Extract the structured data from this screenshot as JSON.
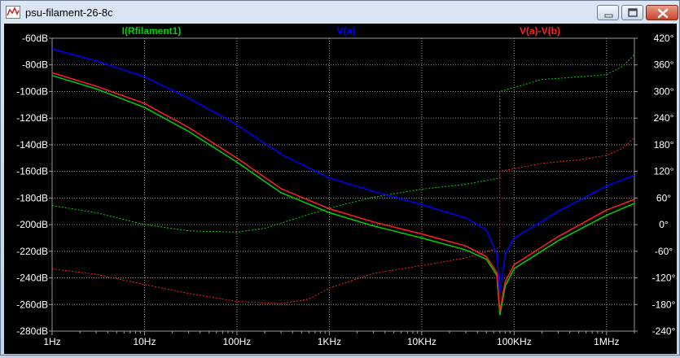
{
  "window": {
    "title": "psu-filament-26-8c",
    "minimize_label": "",
    "maximize_label": "",
    "close_label": ""
  },
  "colors": {
    "background": "#000000",
    "grid": "#999999",
    "trace_rfilament": "#00d000",
    "trace_va": "#0000ff",
    "trace_vavb": "#ff2020",
    "axis_text": "#ffffff"
  },
  "chart_data": {
    "type": "line",
    "x_scale": "log",
    "xlim": [
      1,
      2000000
    ],
    "ylim_left": [
      -280,
      -60
    ],
    "ylim_right": [
      -240,
      420
    ],
    "x_ticks": [
      {
        "value": 1,
        "label": "1Hz"
      },
      {
        "value": 10,
        "label": "10Hz"
      },
      {
        "value": 100,
        "label": "100Hz"
      },
      {
        "value": 1000,
        "label": "1KHz"
      },
      {
        "value": 10000,
        "label": "10KHz"
      },
      {
        "value": 100000,
        "label": "100KHz"
      },
      {
        "value": 1000000,
        "label": "1MHz"
      }
    ],
    "y_ticks_left": [
      {
        "value": -60,
        "label": "-60dB"
      },
      {
        "value": -80,
        "label": "-80dB"
      },
      {
        "value": -100,
        "label": "-100dB"
      },
      {
        "value": -120,
        "label": "-120dB"
      },
      {
        "value": -140,
        "label": "-140dB"
      },
      {
        "value": -160,
        "label": "-160dB"
      },
      {
        "value": -180,
        "label": "-180dB"
      },
      {
        "value": -200,
        "label": "-200dB"
      },
      {
        "value": -220,
        "label": "-220dB"
      },
      {
        "value": -240,
        "label": "-240dB"
      },
      {
        "value": -260,
        "label": "-260dB"
      },
      {
        "value": -280,
        "label": "-280dB"
      }
    ],
    "y_ticks_right": [
      {
        "value": 420,
        "label": "420°"
      },
      {
        "value": 360,
        "label": "360°"
      },
      {
        "value": 300,
        "label": "300°"
      },
      {
        "value": 240,
        "label": "240°"
      },
      {
        "value": 180,
        "label": "180°"
      },
      {
        "value": 120,
        "label": "120°"
      },
      {
        "value": 60,
        "label": "60°"
      },
      {
        "value": 0,
        "label": "0°"
      },
      {
        "value": -60,
        "label": "-60°"
      },
      {
        "value": -120,
        "label": "-120°"
      },
      {
        "value": -180,
        "label": "-180°"
      },
      {
        "value": -240,
        "label": "-240°"
      }
    ],
    "grid": true,
    "series": [
      {
        "name": "I(Rfilament1)",
        "color": "#00d000",
        "magnitude": [
          [
            1,
            -88
          ],
          [
            3,
            -98
          ],
          [
            10,
            -112
          ],
          [
            30,
            -130
          ],
          [
            100,
            -153
          ],
          [
            300,
            -176
          ],
          [
            1000,
            -191
          ],
          [
            3000,
            -201
          ],
          [
            10000,
            -210
          ],
          [
            30000,
            -219
          ],
          [
            50000,
            -226
          ],
          [
            65000,
            -238
          ],
          [
            70000,
            -268
          ],
          [
            80000,
            -246
          ],
          [
            100000,
            -233
          ],
          [
            300000,
            -212
          ],
          [
            1000000,
            -193
          ],
          [
            2000000,
            -184
          ]
        ],
        "phase": [
          [
            1,
            43
          ],
          [
            3,
            27
          ],
          [
            10,
            0
          ],
          [
            30,
            -14
          ],
          [
            100,
            -17
          ],
          [
            200,
            -8
          ],
          [
            500,
            18
          ],
          [
            1000,
            37
          ],
          [
            3000,
            62
          ],
          [
            10000,
            80
          ],
          [
            30000,
            91
          ],
          [
            70000,
            105
          ],
          [
            70001,
            300
          ],
          [
            200000,
            327
          ],
          [
            500000,
            333
          ],
          [
            1000000,
            338
          ],
          [
            1500000,
            357
          ],
          [
            2000000,
            383
          ]
        ]
      },
      {
        "name": "V(a)",
        "color": "#0000ff",
        "magnitude": [
          [
            1,
            -68
          ],
          [
            3,
            -77
          ],
          [
            10,
            -89
          ],
          [
            30,
            -105
          ],
          [
            100,
            -125
          ],
          [
            300,
            -147
          ],
          [
            1000,
            -165
          ],
          [
            3000,
            -175
          ],
          [
            10000,
            -185
          ],
          [
            30000,
            -195
          ],
          [
            50000,
            -204
          ],
          [
            65000,
            -222
          ],
          [
            70000,
            -251
          ],
          [
            80000,
            -222
          ],
          [
            100000,
            -210
          ],
          [
            300000,
            -190
          ],
          [
            1000000,
            -171
          ],
          [
            2000000,
            -163
          ]
        ],
        "phase": []
      },
      {
        "name": "V(a)-V(b)",
        "color": "#ff2020",
        "magnitude": [
          [
            1,
            -86
          ],
          [
            3,
            -96
          ],
          [
            10,
            -109
          ],
          [
            30,
            -127
          ],
          [
            100,
            -150
          ],
          [
            300,
            -173
          ],
          [
            1000,
            -188
          ],
          [
            3000,
            -198
          ],
          [
            10000,
            -207
          ],
          [
            30000,
            -216
          ],
          [
            50000,
            -224
          ],
          [
            65000,
            -236
          ],
          [
            70000,
            -265
          ],
          [
            80000,
            -243
          ],
          [
            100000,
            -230
          ],
          [
            300000,
            -209
          ],
          [
            1000000,
            -189
          ],
          [
            2000000,
            -181
          ]
        ],
        "phase": [
          [
            1,
            -100
          ],
          [
            3,
            -112
          ],
          [
            10,
            -135
          ],
          [
            30,
            -155
          ],
          [
            100,
            -173
          ],
          [
            300,
            -178
          ],
          [
            600,
            -168
          ],
          [
            1000,
            -143
          ],
          [
            3000,
            -110
          ],
          [
            10000,
            -92
          ],
          [
            30000,
            -75
          ],
          [
            70000,
            -52
          ],
          [
            70001,
            120
          ],
          [
            200000,
            138
          ],
          [
            500000,
            146
          ],
          [
            1000000,
            156
          ],
          [
            1500000,
            172
          ],
          [
            2000000,
            196
          ]
        ]
      }
    ]
  }
}
